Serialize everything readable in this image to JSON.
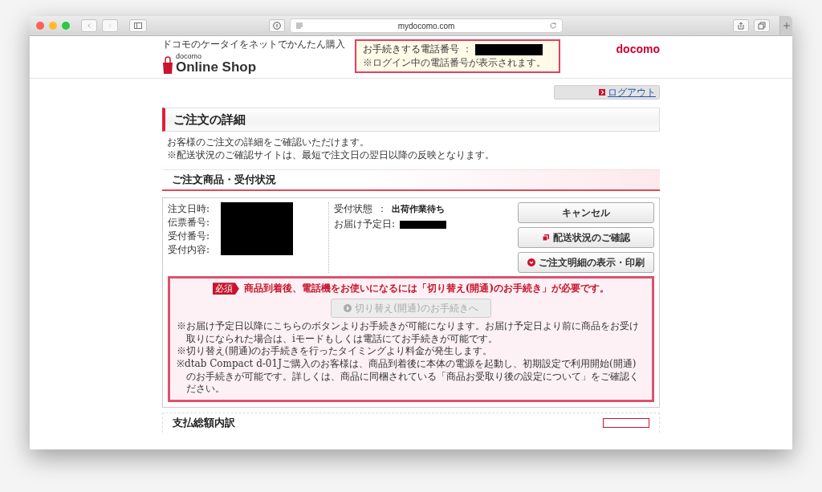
{
  "browser": {
    "url": "mydocomo.com"
  },
  "header": {
    "tagline": "ドコモのケータイをネットでかんたん購入",
    "logo_small": "docomo",
    "logo_main": "Online Shop",
    "phone_label": "お手続きする電話番号 ：",
    "phone_note": "※ログイン中の電話番号が表示されます。",
    "brand": "docomo"
  },
  "logout": "ログアウト",
  "page_title": "ご注文の詳細",
  "intro": [
    "お客様のご注文の詳細をご確認いただけます。",
    "※配送状況のご確認サイトは、最短で注文日の翌日以降の反映となります。"
  ],
  "section_title": "ご注文商品・受付状況",
  "order_fields": [
    {
      "label": "注文日時:"
    },
    {
      "label": "伝票番号:"
    },
    {
      "label": "受付番号:"
    },
    {
      "label": "受付内容:"
    }
  ],
  "status": {
    "label": "受付状態",
    "separator": "：",
    "value": "出荷作業待ち",
    "delivery_label": "お届け予定日:"
  },
  "actions": [
    {
      "label": "キャンセル",
      "kind": "plain"
    },
    {
      "label": "配送状況のご確認",
      "kind": "external"
    },
    {
      "label": "ご注文明細の表示・印刷",
      "kind": "expand"
    }
  ],
  "notice": {
    "badge": "必須",
    "message": "商品到着後、電話機をお使いになるには「切り替え(開通)のお手続き」が必要です。",
    "button": {
      "label": "切り替え(開通)のお手続きへ",
      "disabled": true
    },
    "notes": [
      "※お届け予定日以降にこちらのボタンよりお手続きが可能になります。お届け予定日より前に商品をお受け取りになられた場合は、iモードもしくは電話にてお手続きが可能です。",
      "※切り替え(開通)のお手続きを行ったタイミングより料金が発生します。",
      "※dtab Compact d-01Jご購入のお客様は、商品到着後に本体の電源を起動し、初期設定で利用開始(開通)のお手続きが可能です。詳しくは、商品に同梱されている「商品お受取り後の設定について」をご確認ください。"
    ]
  },
  "next_section": {
    "title": "支払総額内訳"
  }
}
